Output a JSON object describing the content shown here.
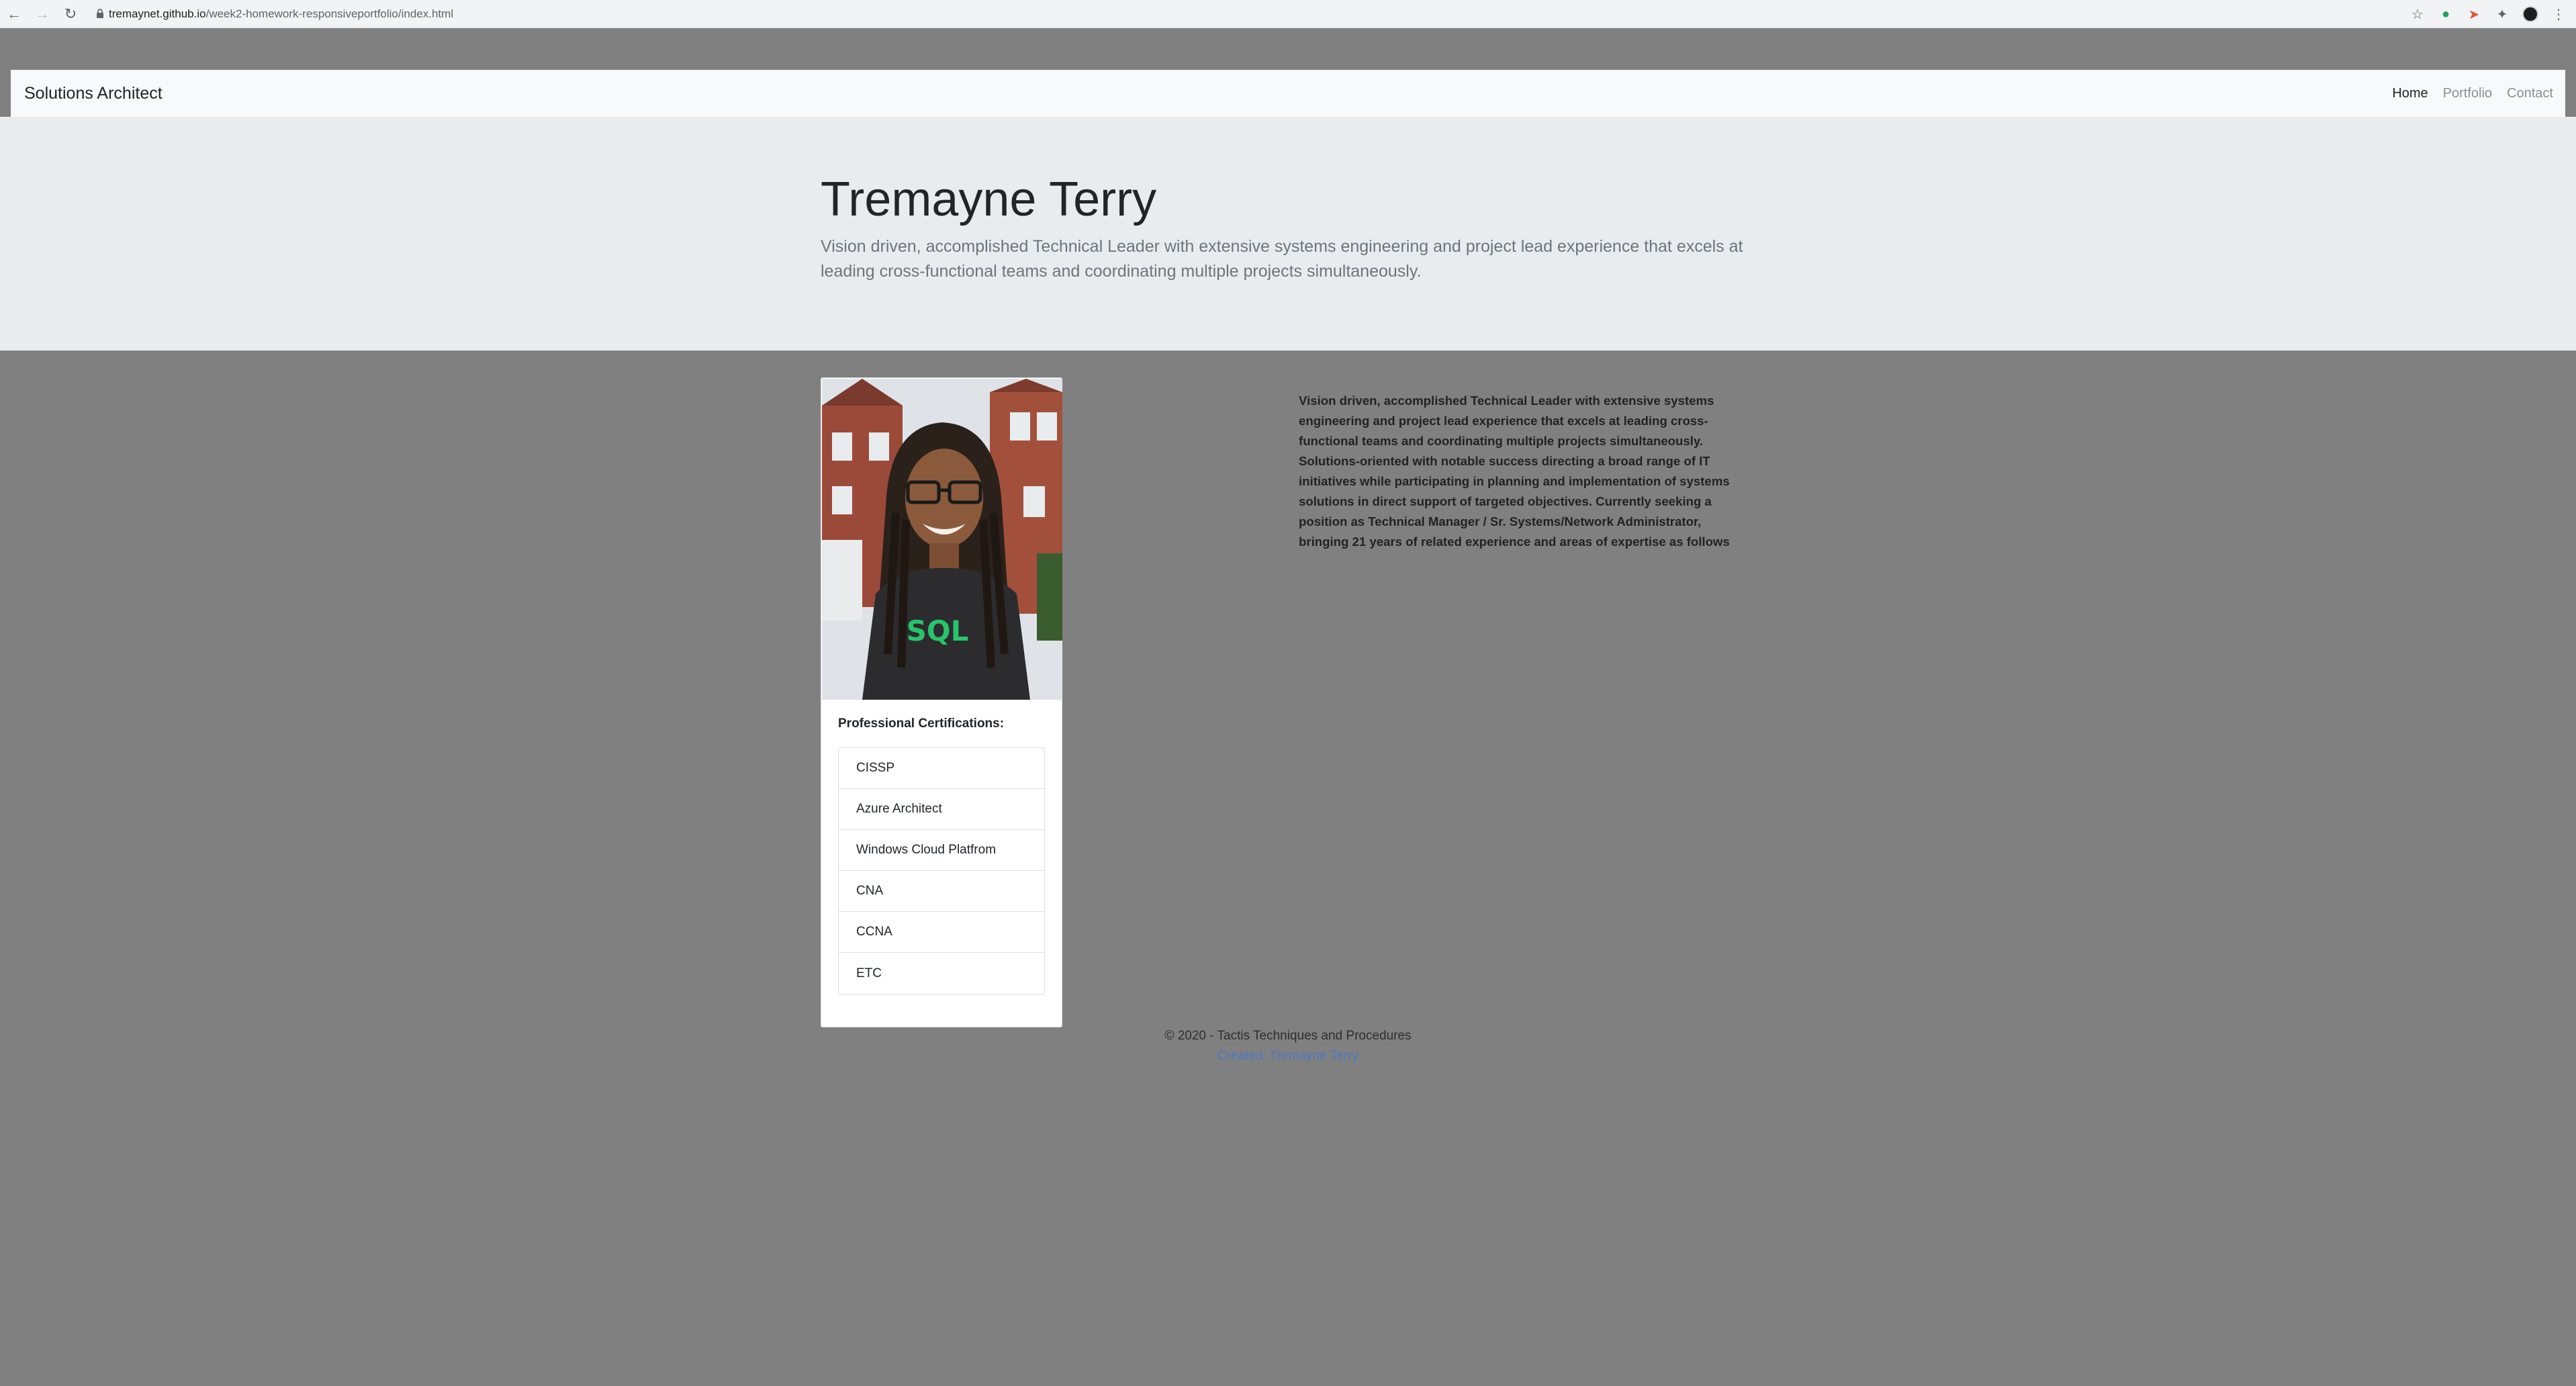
{
  "browser": {
    "url_host": "tremaynet.github.io",
    "url_path": "/week2-homework-responsiveportfolio/index.html"
  },
  "navbar": {
    "brand": "Solutions Architect",
    "links": [
      {
        "label": "Home",
        "active": true
      },
      {
        "label": "Portfolio",
        "active": false
      },
      {
        "label": "Contact",
        "active": false
      }
    ]
  },
  "hero": {
    "title": "Tremayne Terry",
    "lead": "Vision driven, accomplished Technical Leader with extensive systems engineering and project lead experience that excels at leading cross-functional teams and coordinating multiple projects simultaneously."
  },
  "card": {
    "title": "Professional Certifications:",
    "certifications": [
      "CISSP",
      "Azure Architect",
      "Windows Cloud Platfrom",
      "CNA",
      "CCNA",
      "ETC"
    ]
  },
  "summary": {
    "text": "Vision driven, accomplished Technical Leader with extensive systems engineering and project lead experience that excels at leading cross-functional teams and coordinating multiple projects simultaneously. Solutions-oriented with notable success directing a broad range of IT initiatives while participating in planning and implementation of systems solutions in direct support of targeted objectives. Currently seeking a position as Technical Manager / Sr. Systems/Network Administrator, bringing 21 years of related experience and areas of expertise as follows"
  },
  "footer": {
    "copyright": "© 2020 - Tactis Techniques and Procedures",
    "link": "Created: Tremayne Terry"
  },
  "colors": {
    "page_bg": "#808080",
    "jumbotron_bg": "#e9ecef",
    "navbar_bg": "#f8f9fa",
    "link": "#4a78c4"
  }
}
